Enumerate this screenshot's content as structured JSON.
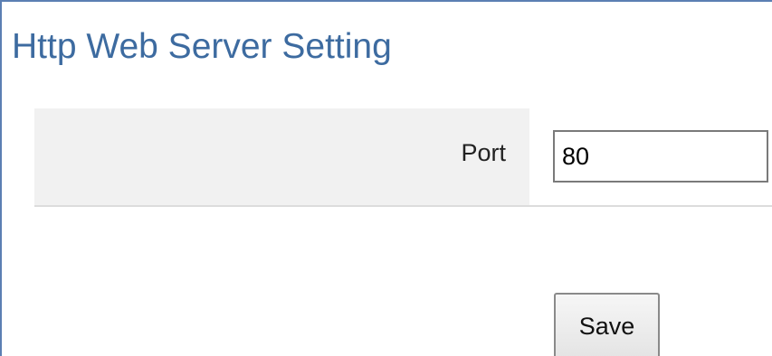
{
  "page": {
    "title": "Http Web Server Setting"
  },
  "form": {
    "port_label": "Port",
    "port_value": "80",
    "save_label": "Save"
  },
  "colors": {
    "title": "#3d6ba0",
    "frame_border": "#5b7fb3",
    "label_background": "#f1f1f1"
  }
}
